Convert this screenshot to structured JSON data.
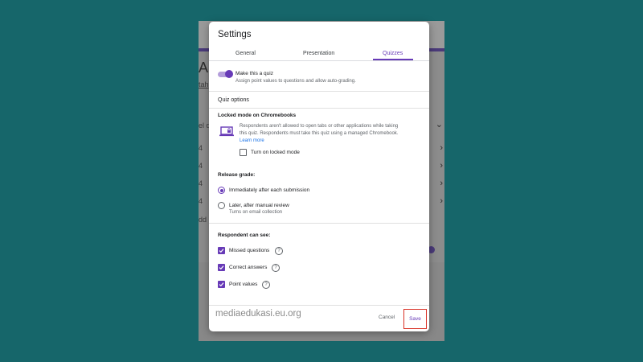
{
  "background": {
    "title_fragment": "A",
    "link_fragment": "tah",
    "label_fragment": "el d",
    "row_numbers": [
      "4",
      "4",
      "4",
      "4"
    ],
    "add_fragment": "dd"
  },
  "dialog": {
    "title": "Settings",
    "tabs": [
      {
        "label": "General"
      },
      {
        "label": "Presentation"
      },
      {
        "label": "Quizzes"
      }
    ],
    "quiz_toggle": {
      "label": "Make this a quiz",
      "description": "Assign point values to questions and allow auto-grading.",
      "on": true
    },
    "quiz_options_heading": "Quiz options",
    "locked_mode": {
      "heading": "Locked mode on Chromebooks",
      "description_line1": "Respondents aren't allowed to open tabs or other applications while taking",
      "description_line2": "this quiz. Respondents must take this quiz using a managed Chromebook.",
      "learn_more": "Learn more",
      "checkbox_label": "Turn on locked mode",
      "checked": false
    },
    "release_grade": {
      "heading": "Release grade:",
      "options": [
        {
          "label": "Immediately after each submission",
          "sub": "",
          "selected": true
        },
        {
          "label": "Later, after manual review",
          "sub": "Turns on email collection",
          "selected": false
        }
      ]
    },
    "respondent_can_see": {
      "heading": "Respondent can see:",
      "items": [
        {
          "label": "Missed questions",
          "checked": true
        },
        {
          "label": "Correct answers",
          "checked": true
        },
        {
          "label": "Point values",
          "checked": true
        }
      ]
    },
    "watermark": "mediaedukasi.eu.org",
    "cancel_label": "Cancel",
    "save_label": "Save"
  },
  "colors": {
    "accent": "#673ab7",
    "highlight": "#d93025",
    "backdrop": "#16666a"
  }
}
